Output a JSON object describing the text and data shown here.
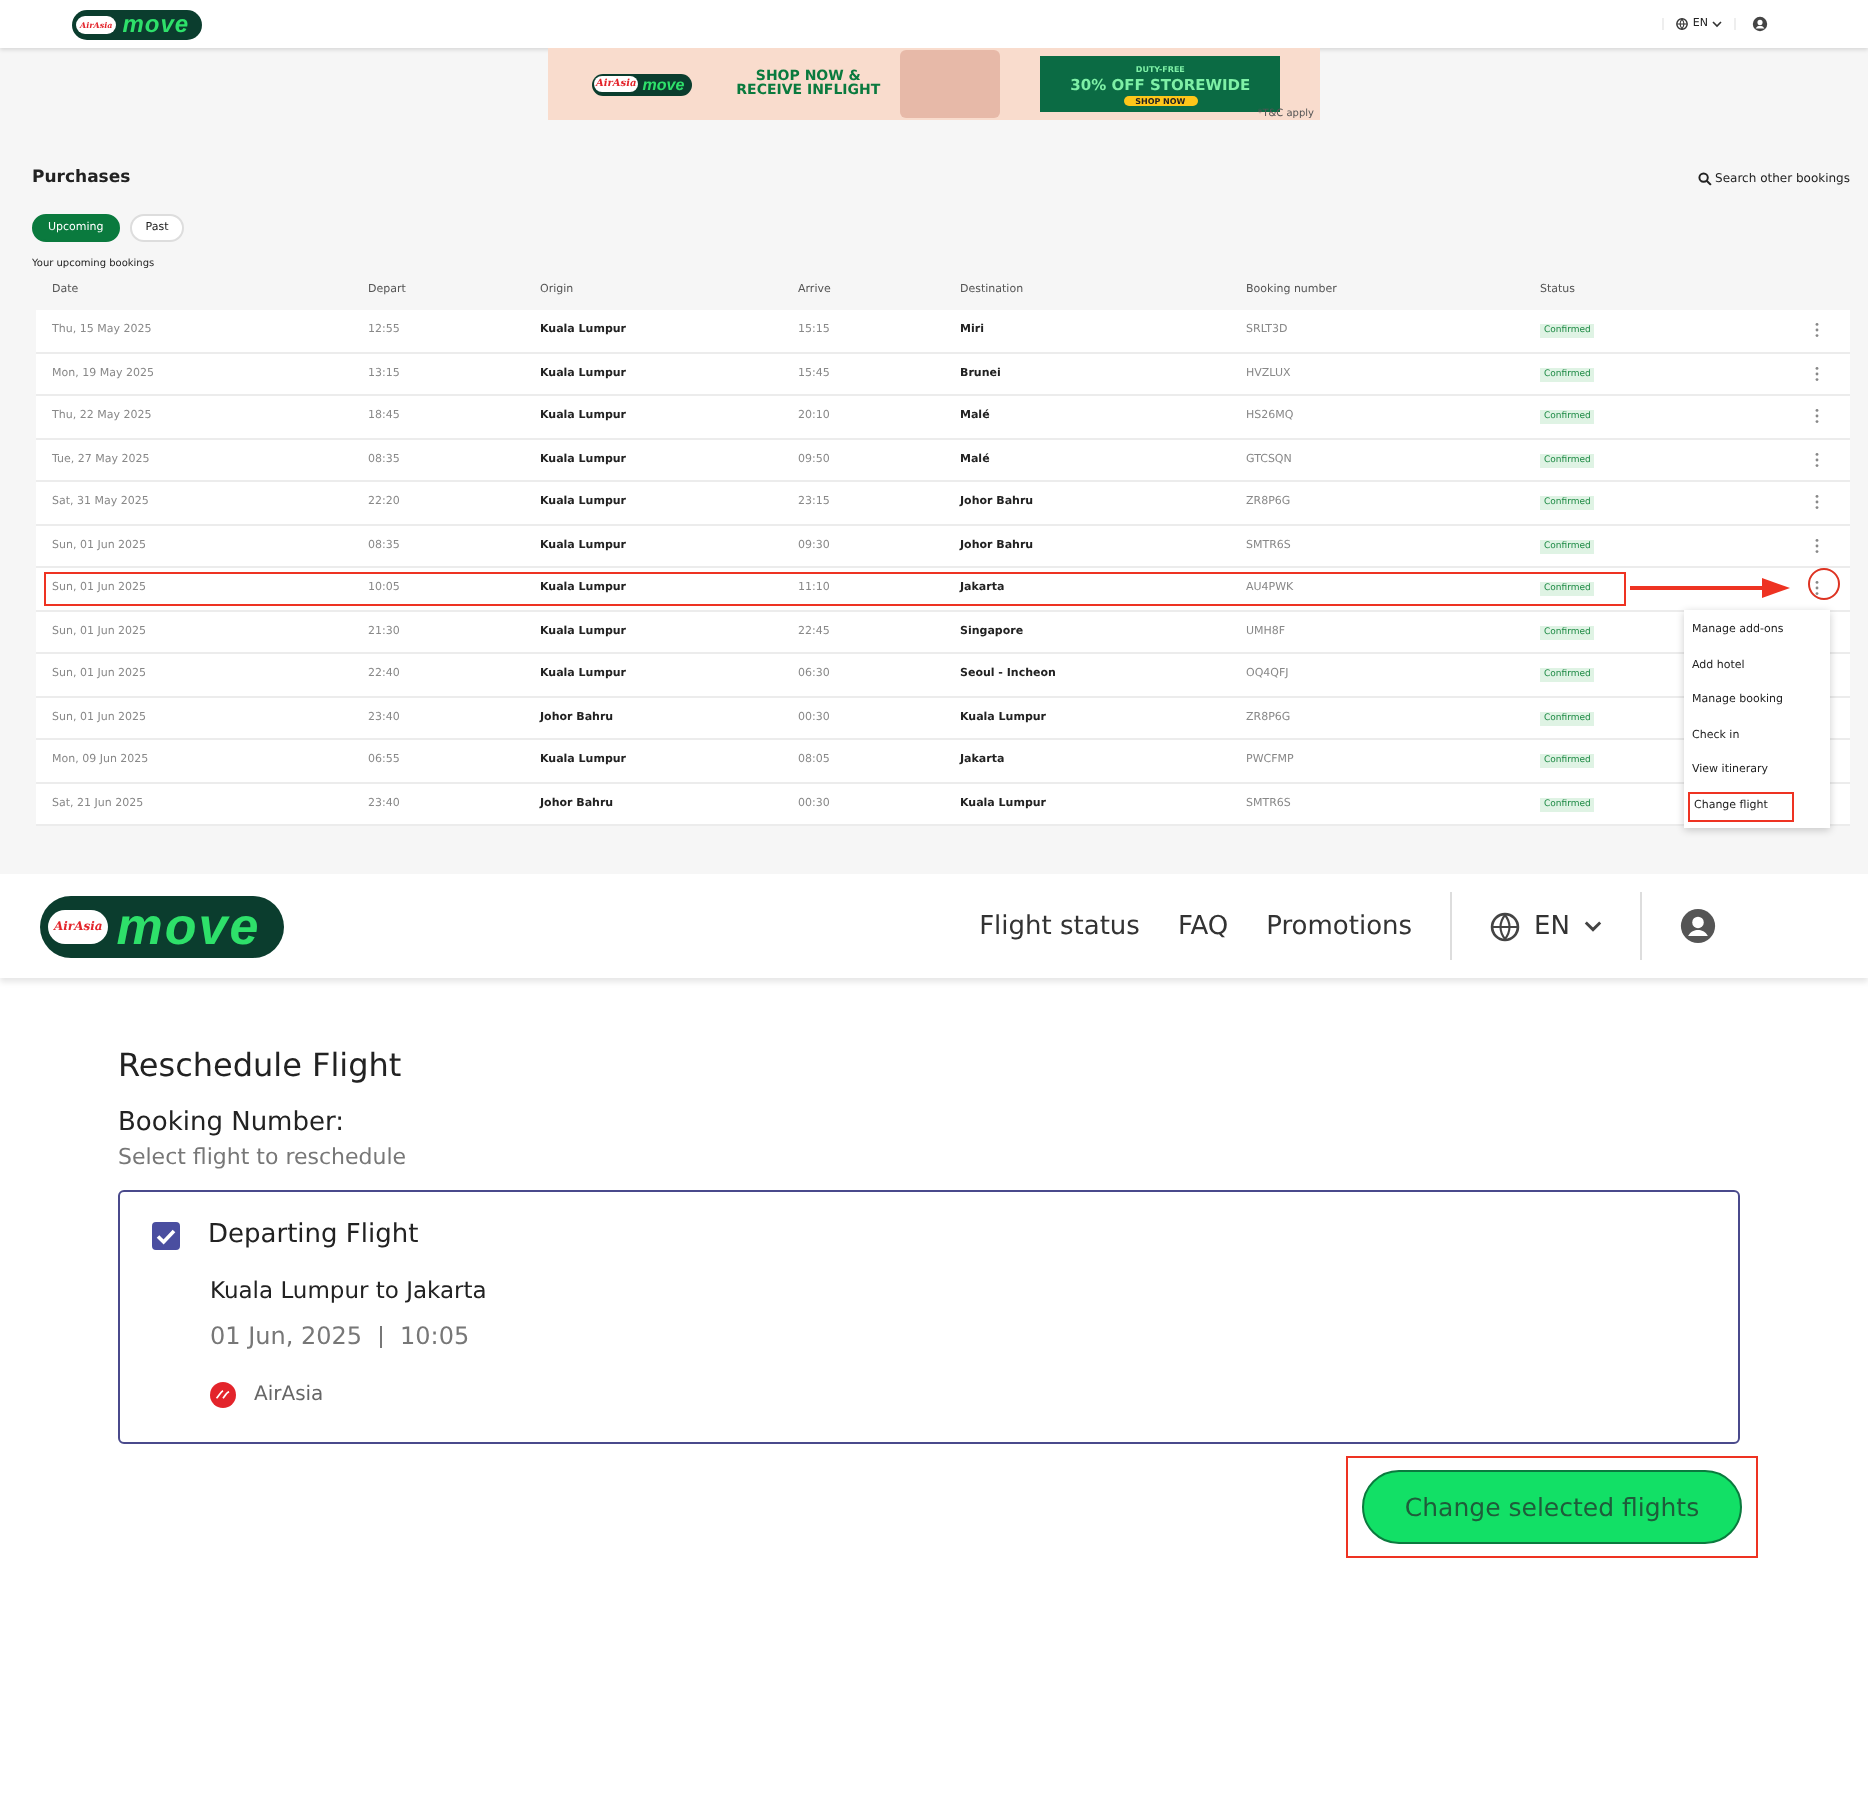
{
  "top_header": {
    "logo": {
      "brand": "AirAsia",
      "word": "move"
    },
    "language": "EN"
  },
  "ad_banner": {
    "logo": {
      "brand": "AirAsia",
      "word": "move"
    },
    "headline": "SHOP NOW & RECEIVE INFLIGHT",
    "tag": "DUTY-FREE",
    "offer": "30% OFF STOREWIDE",
    "cta": "SHOP NOW",
    "fine_print": "*T&C apply"
  },
  "purchases": {
    "title": "Purchases",
    "search_link": "Search other bookings",
    "tabs": [
      {
        "label": "Upcoming",
        "selected": true
      },
      {
        "label": "Past",
        "selected": false
      }
    ],
    "subtitle": "Your upcoming bookings",
    "columns": [
      "Date",
      "Depart",
      "Origin",
      "Arrive",
      "Destination",
      "Booking number",
      "Status"
    ],
    "rows": [
      {
        "date": "Thu, 15 May 2025",
        "depart": "12:55",
        "origin": "Kuala Lumpur",
        "arrive": "15:15",
        "destination": "Miri",
        "booking": "SRLT3D",
        "status": "Confirmed",
        "highlighted": false
      },
      {
        "date": "Mon, 19 May 2025",
        "depart": "13:15",
        "origin": "Kuala Lumpur",
        "arrive": "15:45",
        "destination": "Brunei",
        "booking": "HVZLUX",
        "status": "Confirmed",
        "highlighted": false
      },
      {
        "date": "Thu, 22 May 2025",
        "depart": "18:45",
        "origin": "Kuala Lumpur",
        "arrive": "20:10",
        "destination": "Malé",
        "booking": "HS26MQ",
        "status": "Confirmed",
        "highlighted": false
      },
      {
        "date": "Tue, 27 May 2025",
        "depart": "08:35",
        "origin": "Kuala Lumpur",
        "arrive": "09:50",
        "destination": "Malé",
        "booking": "GTCSQN",
        "status": "Confirmed",
        "highlighted": false
      },
      {
        "date": "Sat, 31 May 2025",
        "depart": "22:20",
        "origin": "Kuala Lumpur",
        "arrive": "23:15",
        "destination": "Johor Bahru",
        "booking": "ZR8P6G",
        "status": "Confirmed",
        "highlighted": false
      },
      {
        "date": "Sun, 01 Jun 2025",
        "depart": "08:35",
        "origin": "Kuala Lumpur",
        "arrive": "09:30",
        "destination": "Johor Bahru",
        "booking": "SMTR6S",
        "status": "Confirmed",
        "highlighted": false
      },
      {
        "date": "Sun, 01 Jun 2025",
        "depart": "10:05",
        "origin": "Kuala Lumpur",
        "arrive": "11:10",
        "destination": "Jakarta",
        "booking": "AU4PWK",
        "status": "Confirmed",
        "highlighted": true
      },
      {
        "date": "Sun, 01 Jun 2025",
        "depart": "21:30",
        "origin": "Kuala Lumpur",
        "arrive": "22:45",
        "destination": "Singapore",
        "booking": "UMH8F",
        "status": "Confirmed",
        "highlighted": false
      },
      {
        "date": "Sun, 01 Jun 2025",
        "depart": "22:40",
        "origin": "Kuala Lumpur",
        "arrive": "06:30",
        "destination": "Seoul - Incheon",
        "booking": "OQ4QFJ",
        "status": "Confirmed",
        "highlighted": false
      },
      {
        "date": "Sun, 01 Jun 2025",
        "depart": "23:40",
        "origin": "Johor Bahru",
        "arrive": "00:30",
        "destination": "Kuala Lumpur",
        "booking": "ZR8P6G",
        "status": "Confirmed",
        "highlighted": false
      },
      {
        "date": "Mon, 09 Jun 2025",
        "depart": "06:55",
        "origin": "Kuala Lumpur",
        "arrive": "08:05",
        "destination": "Jakarta",
        "booking": "PWCFMP",
        "status": "Confirmed",
        "highlighted": false
      },
      {
        "date": "Sat, 21 Jun 2025",
        "depart": "23:40",
        "origin": "Johor Bahru",
        "arrive": "00:30",
        "destination": "Kuala Lumpur",
        "booking": "SMTR6S",
        "status": "Confirmed",
        "highlighted": false
      }
    ],
    "menu": [
      {
        "label": "Manage add-ons",
        "highlighted": false
      },
      {
        "label": "Add hotel",
        "highlighted": false
      },
      {
        "label": "Manage booking",
        "highlighted": false
      },
      {
        "label": "Check in",
        "highlighted": false
      },
      {
        "label": "View itinerary",
        "highlighted": false
      },
      {
        "label": "Change flight",
        "highlighted": true
      }
    ]
  },
  "header": {
    "logo": {
      "brand": "AirAsia",
      "word": "move"
    },
    "nav": [
      "Flight status",
      "FAQ",
      "Promotions"
    ],
    "language": "EN"
  },
  "reschedule": {
    "title": "Reschedule Flight",
    "booking_label": "Booking Number:",
    "hint": "Select flight to reschedule",
    "flights": [
      {
        "title": "Departing Flight",
        "checked": true,
        "route": "Kuala Lumpur to Jakarta",
        "date": "01 Jun, 2025",
        "time": "10:05",
        "airline": "AirAsia"
      }
    ],
    "button": {
      "label": "Change selected flights",
      "highlighted": true
    }
  }
}
